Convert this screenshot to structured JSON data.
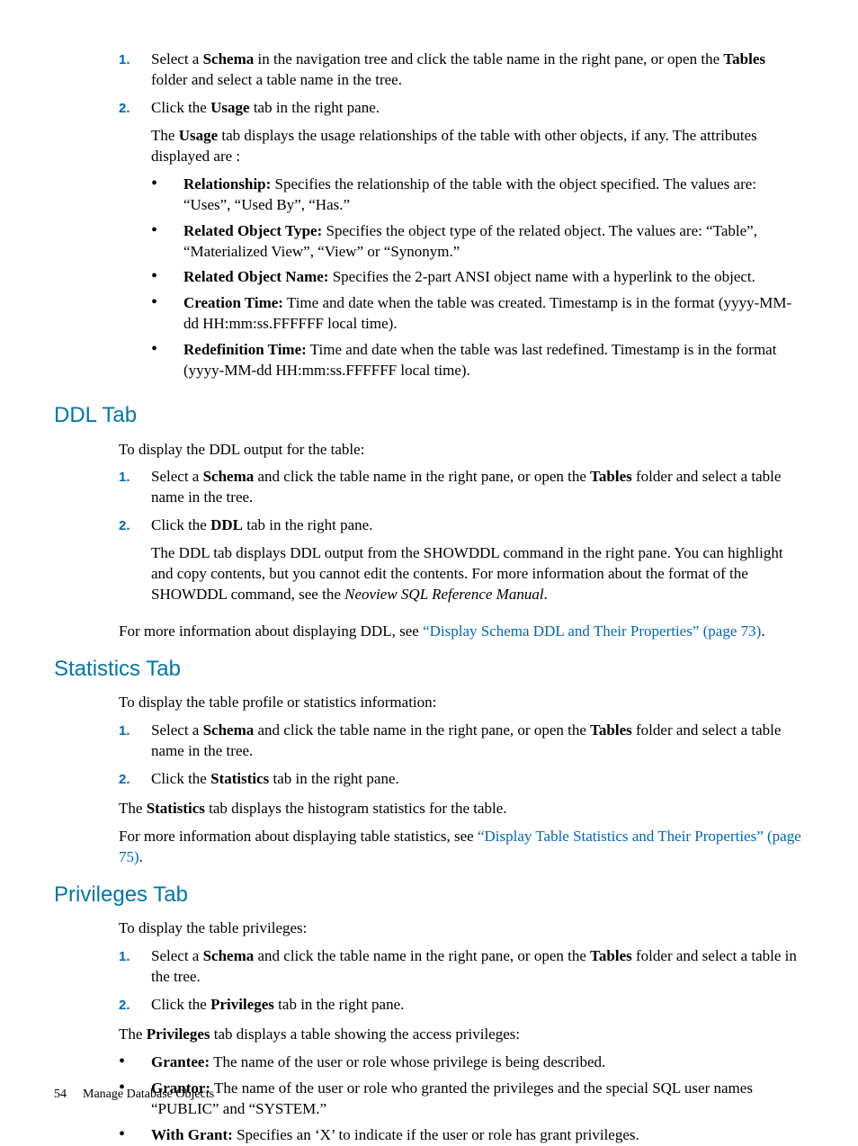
{
  "top_list": {
    "n1": "1.",
    "i1_a": "Select a ",
    "i1_schema": "Schema",
    "i1_b": " in the navigation tree and click the table name in the right pane, or open the ",
    "i1_tables": "Tables",
    "i1_c": " folder and select a table name in the tree.",
    "n2": "2.",
    "i2_a": "Click the ",
    "i2_usage": "Usage",
    "i2_b": " tab in the right pane.",
    "p1_a": "The ",
    "p1_usage": "Usage",
    "p1_b": " tab displays the usage relationships of the table with other objects, if any. The attributes displayed are :",
    "b1_label": "Relationship:",
    "b1_text": " Specifies the relationship of the table with the object specified. The values are: “Uses”, “Used By”, “Has.”",
    "b2_label": "Related Object Type:",
    "b2_text": " Specifies the object type of the related object. The values are: “Table”, “Materialized View”, “View” or “Synonym.”",
    "b3_label": "Related Object Name:",
    "b3_text": " Specifies the 2-part ANSI object name with a hyperlink to the object.",
    "b4_label": "Creation Time:",
    "b4_text": " Time and date when the table was created. Timestamp is in the format (yyyy-MM-dd HH:mm:ss.FFFFFF local time).",
    "b5_label": "Redefinition Time:",
    "b5_text": " Time and date when the table was last redefined. Timestamp is in the format (yyyy-MM-dd HH:mm:ss.FFFFFF local time)."
  },
  "ddl": {
    "title": "DDL Tab",
    "intro": "To display the DDL output for the table:",
    "n1": "1.",
    "i1_a": "Select a ",
    "i1_schema": "Schema",
    "i1_b": " and click the table name in the right pane, or open the ",
    "i1_tables": "Tables",
    "i1_c": " folder and select a table name in the tree.",
    "n2": "2.",
    "i2_a": "Click the ",
    "i2_ddl": "DDL",
    "i2_b": " tab in the right pane.",
    "p2_a": "The DDL tab displays DDL output from the SHOWDDL command in the right pane. You can highlight and copy contents, but you cannot edit the contents. For more information about the format of the SHOWDDL command, see the ",
    "p2_ref": "Neoview SQL Reference Manual",
    "p2_b": ".",
    "p3_a": "For more information about displaying DDL, see ",
    "p3_link": "“Display Schema DDL and Their Properties” (page 73)",
    "p3_b": "."
  },
  "stats": {
    "title": "Statistics Tab",
    "intro": "To display the table profile or statistics information:",
    "n1": "1.",
    "i1_a": "Select a ",
    "i1_schema": "Schema",
    "i1_b": " and click the table name in the right pane, or open the ",
    "i1_tables": "Tables",
    "i1_c": " folder and select a table name in the tree.",
    "n2": "2.",
    "i2_a": "Click the ",
    "i2_stats": "Statistics",
    "i2_b": " tab in the right pane.",
    "p1_a": "The ",
    "p1_stats": "Statistics",
    "p1_b": " tab displays the histogram statistics for the table.",
    "p2_a": "For more information about displaying table statistics, see ",
    "p2_link": "“Display Table Statistics and Their Properties” (page 75)",
    "p2_b": "."
  },
  "priv": {
    "title": "Privileges Tab",
    "intro": "To display the table privileges:",
    "n1": "1.",
    "i1_a": "Select a ",
    "i1_schema": "Schema",
    "i1_b": " and click the table name in the right pane, or open the ",
    "i1_tables": "Tables",
    "i1_c": " folder and select a table in the tree.",
    "n2": "2.",
    "i2_a": "Click the ",
    "i2_priv": "Privileges",
    "i2_b": " tab in the right pane.",
    "p1_a": "The ",
    "p1_priv": "Privileges",
    "p1_b": " tab displays a table showing the access privileges:",
    "b1_label": "Grantee:",
    "b1_text": " The name of the user or role whose privilege is being described.",
    "b2_label": "Grantor:",
    "b2_text": " The name of the user or role who granted the privileges and the special SQL user names “PUBLIC” and “SYSTEM.”",
    "b3_label": "With Grant:",
    "b3_text": " Specifies an ‘X’ to indicate if the user or role has grant privileges."
  },
  "footer": {
    "page": "54",
    "chapter": "Manage Database Objects"
  }
}
